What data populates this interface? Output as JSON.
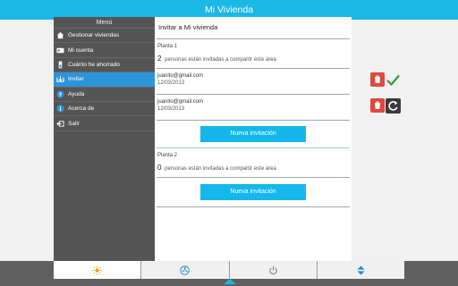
{
  "app": {
    "title": "Mi Vivienda"
  },
  "sidebar": {
    "title": "Menú",
    "items": [
      {
        "label": "Gestionar viviendas",
        "icon": "home-icon"
      },
      {
        "label": "Mi cuenta",
        "icon": "account-card-icon"
      },
      {
        "label": "Cuánto he ahorrado",
        "icon": "savings-icon"
      },
      {
        "label": "Invitar",
        "icon": "invite-icon",
        "active": true
      },
      {
        "label": "Ayuda",
        "icon": "help-icon"
      },
      {
        "label": "Acerca de",
        "icon": "info-icon"
      },
      {
        "label": "Salir",
        "icon": "exit-icon"
      }
    ]
  },
  "main": {
    "title": "Invitar a Mi vivienda",
    "plantas": [
      {
        "label": "Planta 1",
        "count": "2",
        "count_text": "personas están invitadas a compartir este área",
        "invitations": [
          {
            "email": "juanito@gmail.com",
            "date": "12/03/2013",
            "status": "accepted"
          },
          {
            "email": "juanito@gmail.com",
            "date": "12/03/2013",
            "status": "pending"
          }
        ],
        "button_label": "Nueva invitación"
      },
      {
        "label": "Planta 2",
        "count": "0",
        "count_text": "personas están invitadas a compartir este área",
        "invitations": [],
        "button_label": "Nueva invitación"
      }
    ]
  },
  "bottom_tabs": [
    {
      "icon": "sun-icon",
      "active": true
    },
    {
      "icon": "fan-icon"
    },
    {
      "icon": "power-icon"
    },
    {
      "icon": "sort-arrows-icon"
    }
  ],
  "colors": {
    "accent": "#1bb7e5",
    "active_menu": "#2c94d9",
    "sidebar_bg": "#555555",
    "delete_red": "#e0473f",
    "accepted_green": "#2e9d3a"
  }
}
